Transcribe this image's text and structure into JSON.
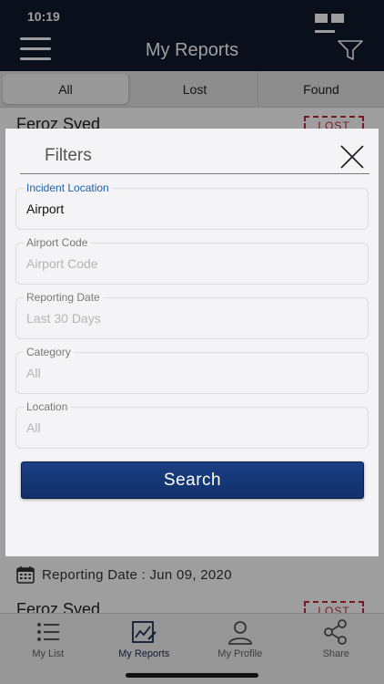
{
  "status_bar": {
    "time": "10:19"
  },
  "nav": {
    "title": "My Reports",
    "menu_icon": "hamburger-menu-icon",
    "filter_icon": "funnel-filter-icon"
  },
  "tabs": [
    {
      "label": "All",
      "active": true
    },
    {
      "label": "Lost",
      "active": false
    },
    {
      "label": "Found",
      "active": false
    }
  ],
  "reports": [
    {
      "name": "Feroz Syed",
      "badge": "LOST"
    },
    {
      "name": "Feroz Syed",
      "badge": "LOST"
    }
  ],
  "report_date": {
    "text": "Reporting Date : Jun 09, 2020",
    "icon": "calendar-icon"
  },
  "tabbar": [
    {
      "label": "My List",
      "icon": "list-icon",
      "active": false
    },
    {
      "label": "My Reports",
      "icon": "report-chart-icon",
      "active": true
    },
    {
      "label": "My Profile",
      "icon": "person-icon",
      "active": false
    },
    {
      "label": "Share",
      "icon": "share-icon",
      "active": false
    }
  ],
  "modal": {
    "title": "Filters",
    "close_icon": "close-icon",
    "fields": [
      {
        "label": "Incident Location",
        "value": "Airport",
        "placeholder": "",
        "focused": true
      },
      {
        "label": "Airport Code",
        "value": "",
        "placeholder": "Airport Code",
        "focused": false
      },
      {
        "label": "Reporting Date",
        "value": "",
        "placeholder": "Last 30 Days",
        "focused": false
      },
      {
        "label": "Category",
        "value": "",
        "placeholder": "All",
        "focused": false
      },
      {
        "label": "Location",
        "value": "",
        "placeholder": "All",
        "focused": false
      }
    ],
    "search_label": "Search"
  },
  "colors": {
    "navy": "#0f1b2e",
    "button": "#1a3f82",
    "accent_label": "#1f5fa8",
    "lost_red": "#c3293a"
  }
}
